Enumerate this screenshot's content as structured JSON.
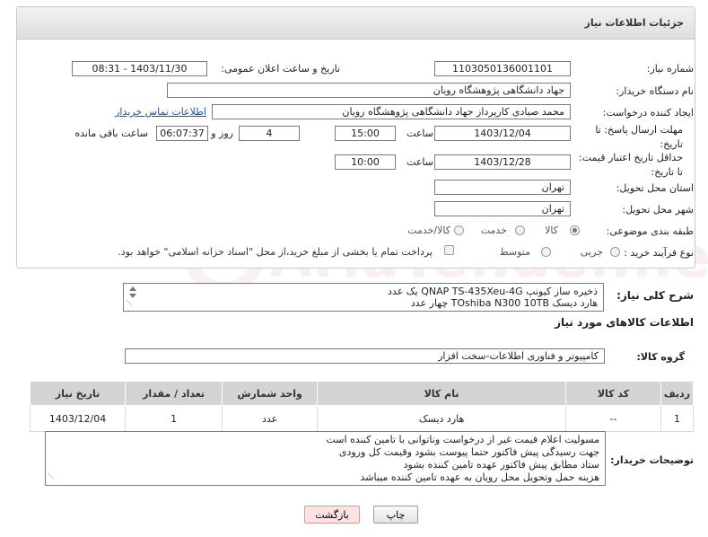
{
  "panel": {
    "title": "جزئیات اطلاعات نیاز"
  },
  "fields": {
    "need_number_label": "شماره نیاز:",
    "need_number": "1103050136001101",
    "announce_label": "تاریخ و ساعت اعلان عمومی:",
    "announce_value": "1403/11/30 - 08:31",
    "buyer_org_label": "نام دستگاه خریدار:",
    "buyer_org": "جهاد دانشگاهی پژوهشگاه رویان",
    "requester_label": "ایجاد کننده درخواست:",
    "requester": "محمد صیادی کارپرداز جهاد دانشگاهی پژوهشگاه رویان",
    "contact_link": "اطلاعات تماس خریدار",
    "deadline_label": "مهلت ارسال پاسخ: تا تاریخ:",
    "deadline_date": "1403/12/04",
    "time_label": "ساعت",
    "deadline_time": "15:00",
    "days_value": "4",
    "days_label": "روز و",
    "remaining_time": "06:07:37",
    "remaining_label": "ساعت باقی مانده",
    "validity_label": "حداقل تاریخ اعتبار قیمت: تا تاریخ:",
    "validity_date": "1403/12/28",
    "validity_time": "10:00",
    "province_label": "استان محل تحویل:",
    "province": "تهران",
    "city_label": "شهر محل تحویل:",
    "city": "تهران",
    "category_label": "طبقه بندی موضوعی:",
    "category_options": [
      "کالا",
      "خدمت",
      "کالا/خدمت"
    ],
    "process_label": "نوع فرآیند خرید :",
    "process_options": [
      "جزیی",
      "متوسط"
    ],
    "payment_note": "پرداخت تمام یا بخشی از مبلغ خرید،از محل \"اسناد خزانه اسلامی\" خواهد بود."
  },
  "description": {
    "label": "شرح کلی نیاز:",
    "line1": "ذخیره ساز کیونپ QNAP TS-435Xeu-4G یک عدد",
    "line2": "هارد دیسک TOshiba N300 10TB چهار عدد"
  },
  "items_section": {
    "title": "اطلاعات کالاهای مورد نیاز",
    "group_label": "گروه کالا:",
    "group_value": "کامپیوتر و فناوری اطلاعات-سخت افزار"
  },
  "table": {
    "headers": [
      "ردیف",
      "کد کالا",
      "نام کالا",
      "واحد شمارش",
      "تعداد / مقدار",
      "تاریخ نیاز"
    ],
    "rows": [
      [
        "1",
        "--",
        "هارد دیسک",
        "عدد",
        "1",
        "1403/12/04"
      ]
    ]
  },
  "buyer_notes": {
    "label": "توضیحات خریدار:",
    "lines": [
      "مسولیت اعلام قیمت  غیر از درخواست وناتوانی با تامین کننده است",
      "جهت رسیدگی پیش فاکتور حتما پیوست بشود وقیمت کل ورودی",
      "ستاد مطابق پیش فاکتور عهده تامین کننده بشود",
      "هزینه حمل وتحویل محل رویان به عهده تامین کننده میباشد"
    ]
  },
  "buttons": {
    "print": "چاپ",
    "back": "بازگشت"
  },
  "watermark": "AriaTender.neT"
}
